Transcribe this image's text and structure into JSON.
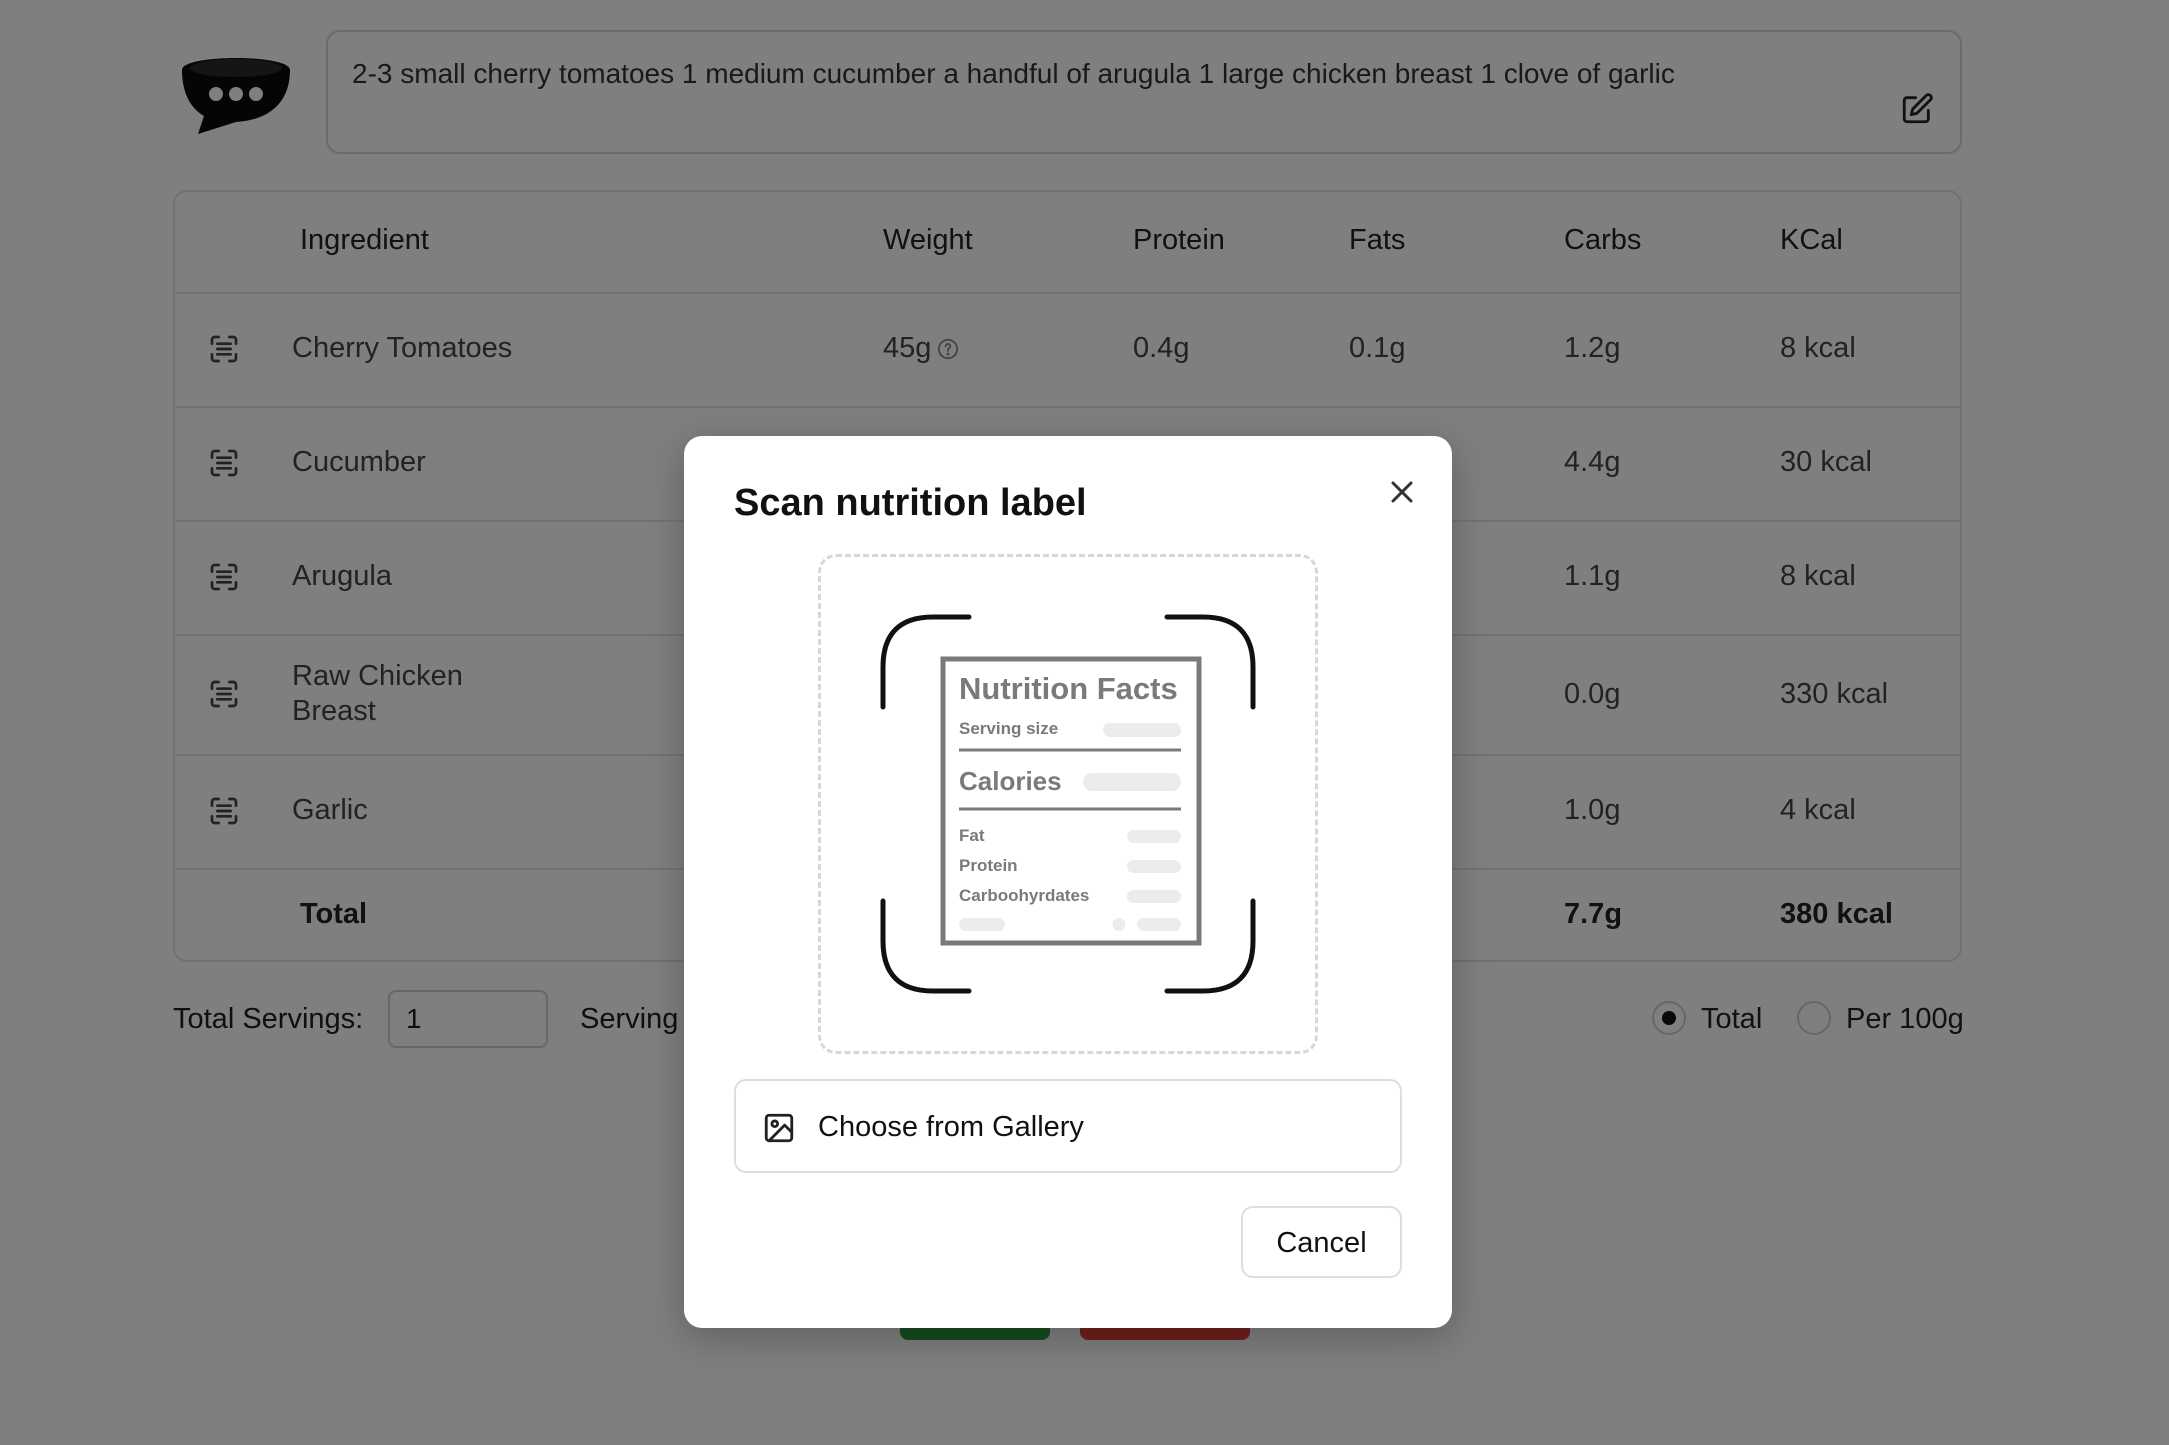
{
  "app": {
    "logo_icon": "chat-bowl-icon"
  },
  "prompt": {
    "text": "2-3 small cherry tomatoes 1 medium cucumber a handful of arugula 1 large chicken breast 1 clove of garlic"
  },
  "table": {
    "headers": {
      "ingredient": "Ingredient",
      "weight": "Weight",
      "protein": "Protein",
      "fats": "Fats",
      "carbs": "Carbs",
      "kcal": "KCal"
    },
    "rows": [
      {
        "ingredient": "Cherry Tomatoes",
        "ingredient_line2": "",
        "weight": "45g",
        "protein": "0.4g",
        "fats": "0.1g",
        "carbs": "1.2g",
        "kcal": "8 kcal"
      },
      {
        "ingredient": "Cucumber",
        "ingredient_line2": "",
        "weight": "",
        "protein": "",
        "fats": "",
        "carbs": "4.4g",
        "kcal": "30 kcal"
      },
      {
        "ingredient": "Arugula",
        "ingredient_line2": "",
        "weight": "",
        "protein": "",
        "fats": "",
        "carbs": "1.1g",
        "kcal": "8 kcal"
      },
      {
        "ingredient": "Raw Chicken",
        "ingredient_line2": "Breast",
        "weight": "",
        "protein": "",
        "fats": "",
        "carbs": "0.0g",
        "kcal": "330 kcal"
      },
      {
        "ingredient": "Garlic",
        "ingredient_line2": "",
        "weight": "",
        "protein": "",
        "fats": "",
        "carbs": "1.0g",
        "kcal": "4 kcal"
      }
    ],
    "total": {
      "label": "Total",
      "carbs": "7.7g",
      "kcal": "380 kcal"
    }
  },
  "servings": {
    "label": "Total Servings:",
    "value": "1",
    "serving_label": "Serving"
  },
  "view_toggle": {
    "selected": "Total",
    "options": [
      "Total",
      "Per 100g"
    ]
  },
  "modal": {
    "title": "Scan nutrition label",
    "gallery_button": "Choose from Gallery",
    "cancel_button": "Cancel",
    "illustration": {
      "heading": "Nutrition Facts",
      "serving_size": "Serving size",
      "calories": "Calories",
      "fat": "Fat",
      "protein": "Protein",
      "carbs": "Carboohyrdates"
    }
  }
}
